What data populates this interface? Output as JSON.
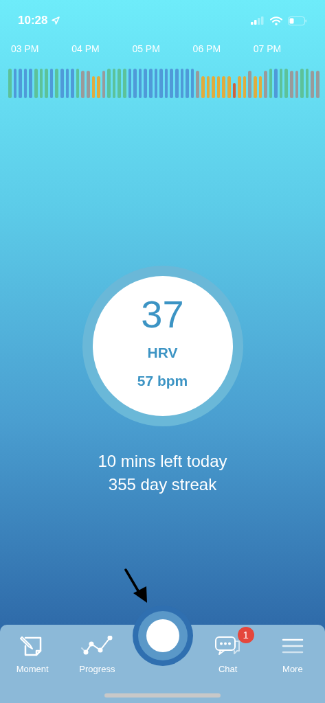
{
  "status_bar": {
    "time": "10:28"
  },
  "timeline": {
    "labels": [
      "03 PM",
      "04 PM",
      "05 PM",
      "06 PM",
      "07 PM"
    ],
    "bars": [
      {
        "color": "#5cc29a"
      },
      {
        "color": "#4f9ad8"
      },
      {
        "color": "#4f9ad8"
      },
      {
        "color": "#4f9ad8"
      },
      {
        "color": "#4f9ad8"
      },
      {
        "color": "#5cc29a"
      },
      {
        "color": "#5cc29a"
      },
      {
        "color": "#5cc29a"
      },
      {
        "color": "#4f9ad8"
      },
      {
        "color": "#5cc29a"
      },
      {
        "color": "#4f9ad8"
      },
      {
        "color": "#4f9ad8"
      },
      {
        "color": "#4f9ad8"
      },
      {
        "color": "#5cc29a"
      },
      {
        "color": "#9a9a9a"
      },
      {
        "color": "#9a9a9a"
      },
      {
        "color": "#e0ac3e"
      },
      {
        "color": "#e0ac3e"
      },
      {
        "color": "#9a9a9a"
      },
      {
        "color": "#5cc29a"
      },
      {
        "color": "#5cc29a"
      },
      {
        "color": "#5cc29a"
      },
      {
        "color": "#5cc29a"
      },
      {
        "color": "#4f9ad8"
      },
      {
        "color": "#4f9ad8"
      },
      {
        "color": "#4f9ad8"
      },
      {
        "color": "#4f9ad8"
      },
      {
        "color": "#4f9ad8"
      },
      {
        "color": "#4f9ad8"
      },
      {
        "color": "#4f9ad8"
      },
      {
        "color": "#4f9ad8"
      },
      {
        "color": "#4f9ad8"
      },
      {
        "color": "#4f9ad8"
      },
      {
        "color": "#4f9ad8"
      },
      {
        "color": "#4f9ad8"
      },
      {
        "color": "#4f9ad8"
      },
      {
        "color": "#9a9a9a"
      },
      {
        "color": "#e0ac3e"
      },
      {
        "color": "#e0ac3e"
      },
      {
        "color": "#e0ac3e"
      },
      {
        "color": "#e0ac3e"
      },
      {
        "color": "#e0ac3e"
      },
      {
        "color": "#e0ac3e"
      },
      {
        "color": "#d0603a"
      },
      {
        "color": "#e0ac3e"
      },
      {
        "color": "#e0ac3e"
      },
      {
        "color": "#9a9a9a"
      },
      {
        "color": "#e0ac3e"
      },
      {
        "color": "#e0ac3e"
      },
      {
        "color": "#9a9a9a"
      },
      {
        "color": "#5cc29a"
      },
      {
        "color": "#4f9ad8"
      },
      {
        "color": "#5cc29a"
      },
      {
        "color": "#5cc29a"
      },
      {
        "color": "#9a9a9a"
      },
      {
        "color": "#9a9a9a"
      },
      {
        "color": "#5cc29a"
      },
      {
        "color": "#5cc29a"
      },
      {
        "color": "#9a9a9a"
      },
      {
        "color": "#9a9a9a"
      }
    ]
  },
  "reading": {
    "value": "37",
    "label": "HRV",
    "heart_rate": "57 bpm"
  },
  "summary": [
    "10 mins left today",
    "355 day streak"
  ],
  "nav": [
    {
      "kind": "moment",
      "label": "Moment"
    },
    {
      "kind": "progress",
      "label": "Progress"
    },
    {
      "kind": "session"
    },
    {
      "kind": "chat",
      "label": "Chat",
      "badge": "1"
    },
    {
      "kind": "more",
      "label": "More"
    }
  ]
}
